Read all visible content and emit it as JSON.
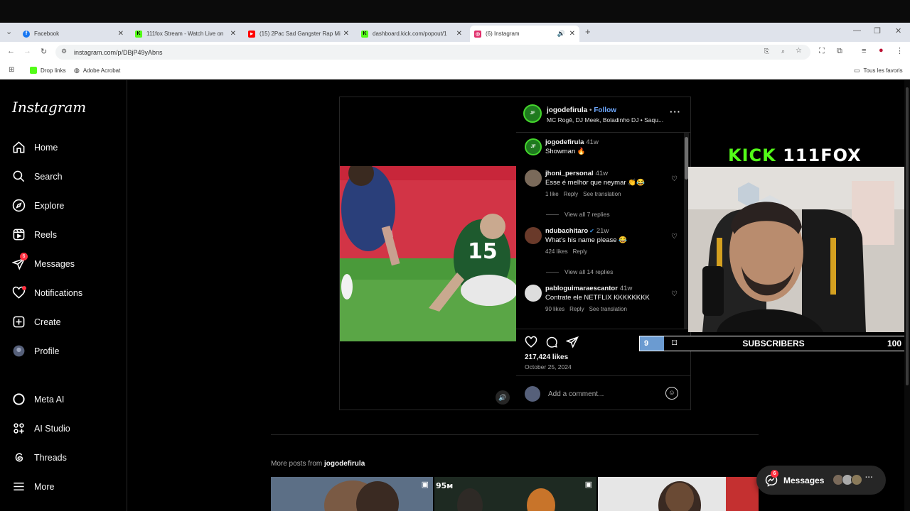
{
  "browser": {
    "tabs": [
      {
        "title": "Facebook",
        "favicon_color": "#1877f2",
        "favicon_char": "f"
      },
      {
        "title": "111fox Stream - Watch Live on",
        "favicon_color": "#53fc18",
        "favicon_char": "K"
      },
      {
        "title": "(15) 2Pac Sad Gangster Rap Mi",
        "favicon_color": "#ff0000",
        "favicon_char": "▶"
      },
      {
        "title": "dashboard.kick.com/popout/1",
        "favicon_color": "#53fc18",
        "favicon_char": "K"
      },
      {
        "title": "(6) Instagram",
        "favicon_color": "#e1306c",
        "favicon_char": "◎"
      }
    ],
    "url": "instagram.com/p/DBjP49yAbns",
    "bookmarks": [
      "Drop links",
      "Adobe Acrobat"
    ],
    "bookmarks_right": "Tous les favoris"
  },
  "sidebar": {
    "logo": "Instagram",
    "items": [
      {
        "label": "Home",
        "icon": "home-icon"
      },
      {
        "label": "Search",
        "icon": "search-icon"
      },
      {
        "label": "Explore",
        "icon": "compass-icon"
      },
      {
        "label": "Reels",
        "icon": "reels-icon"
      },
      {
        "label": "Messages",
        "icon": "messages-icon",
        "badge": "6"
      },
      {
        "label": "Notifications",
        "icon": "heart-icon",
        "dot": true
      },
      {
        "label": "Create",
        "icon": "plus-icon"
      },
      {
        "label": "Profile",
        "icon": "profile-icon"
      },
      {
        "label": "Meta AI",
        "icon": "meta-ai-icon"
      },
      {
        "label": "AI Studio",
        "icon": "ai-studio-icon"
      },
      {
        "label": "Threads",
        "icon": "threads-icon"
      },
      {
        "label": "More",
        "icon": "menu-icon"
      }
    ]
  },
  "post": {
    "author": "jogodefirula",
    "follow": "Follow",
    "audio": "MC Rogê, DJ Meek, Boladinho DJ • Saqu...",
    "caption_user": "jogodefirula",
    "caption_time": "41w",
    "caption_text": "Showman 🔥",
    "comments": [
      {
        "user": "jhoni_personal",
        "time": "41w",
        "text": "Esse é melhor que neymar 👏😂",
        "likes": "1 like",
        "reply": "Reply",
        "translate": "See translation",
        "view_replies": "View all 7 replies"
      },
      {
        "user": "ndubachitaro",
        "time": "21w",
        "text": "What's his name please 😂",
        "likes": "424 likes",
        "reply": "Reply",
        "translate": "",
        "view_replies": "View all 14 replies"
      },
      {
        "user": "pabloguimaraescantor",
        "time": "41w",
        "text": "Contrate ele NETFLIX KKKKKKKK",
        "likes": "90 likes",
        "reply": "Reply",
        "translate": "See translation",
        "view_replies": ""
      }
    ],
    "likes": "217,424 likes",
    "date": "October 25, 2024",
    "add_comment_placeholder": "Add a comment..."
  },
  "overlay": {
    "kick_brand": "KICK",
    "channel": "111FOX",
    "sub_count": "9",
    "sub_label": "SUBSCRIBERS",
    "sub_goal": "100",
    "sub_progress": 0.09
  },
  "more_posts": {
    "label": "More posts from",
    "user": "jogodefirula"
  },
  "messages_pill": {
    "label": "Messages",
    "badge": "6"
  }
}
